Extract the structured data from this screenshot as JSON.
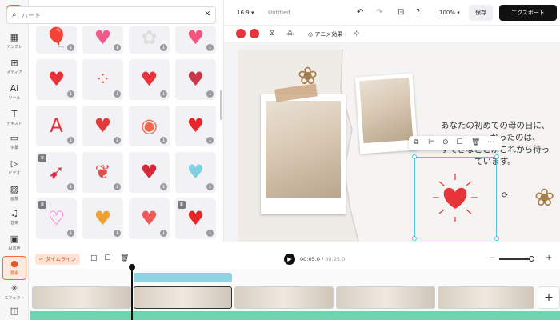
{
  "app": {
    "logo": "F"
  },
  "rail": {
    "items": [
      {
        "label": "テンプレ",
        "icon": "▦",
        "icon_name": "template-icon"
      },
      {
        "label": "メディア",
        "icon": "⊞",
        "icon_name": "media-icon"
      },
      {
        "label": "ツール",
        "icon": "AI",
        "icon_name": "ai-tools-icon"
      },
      {
        "label": "テキスト",
        "icon": "T",
        "icon_name": "text-icon"
      },
      {
        "label": "字幕",
        "icon": "▭",
        "icon_name": "subtitle-icon"
      },
      {
        "label": "ビデオ",
        "icon": "▷",
        "icon_name": "video-icon"
      },
      {
        "label": "画像",
        "icon": "▨",
        "icon_name": "image-icon"
      },
      {
        "label": "音楽",
        "icon": "♫",
        "icon_name": "music-icon"
      },
      {
        "label": "AI音声",
        "icon": "▣",
        "icon_name": "ai-voice-icon"
      },
      {
        "label": "要素",
        "icon": "●",
        "icon_name": "elements-icon"
      },
      {
        "label": "エフェクト",
        "icon": "✳",
        "icon_name": "effects-icon"
      },
      {
        "label": "",
        "icon": "◫",
        "icon_name": "more-icon"
      }
    ]
  },
  "search": {
    "placeholder": "ハート",
    "value": "ハート"
  },
  "stickers": [
    {
      "glyph": "🎈",
      "color": "#c0405a"
    },
    {
      "glyph": "♥",
      "color": "#f05a8a"
    },
    {
      "glyph": "✿",
      "color": "#dddddd"
    },
    {
      "glyph": "♥",
      "color": "#f5557a"
    },
    {
      "glyph": "♥",
      "color": "#e8333a"
    },
    {
      "glyph": "⁘",
      "color": "#e86a5a"
    },
    {
      "glyph": "♥",
      "color": "#e8333a"
    },
    {
      "glyph": "♥",
      "color": "#c83a4a"
    },
    {
      "glyph": "A",
      "color": "#e8333a"
    },
    {
      "glyph": "♥",
      "color": "#e03a3a"
    },
    {
      "glyph": "◉",
      "color": "#f06a50"
    },
    {
      "glyph": "♥",
      "color": "#e8262a"
    },
    {
      "glyph": "➹",
      "color": "#d8334a"
    },
    {
      "glyph": "❦",
      "color": "#e84a4a"
    },
    {
      "glyph": "♥",
      "color": "#d8263a"
    },
    {
      "glyph": "♥",
      "color": "#7fd0e0"
    },
    {
      "glyph": "♡",
      "color": "#ff4fcf"
    },
    {
      "glyph": "♥",
      "color": "#f0a030"
    },
    {
      "glyph": "♥",
      "color": "#f05a5a"
    },
    {
      "glyph": "♥",
      "color": "#e8262a"
    }
  ],
  "topbar": {
    "aspect": "16:9",
    "title": "Untitled",
    "zoom": "100%",
    "save": "保存",
    "export": "エクスポート"
  },
  "toolbar": {
    "colors": [
      "#e8333a",
      "#e8333a"
    ],
    "animate": "アニメ効果"
  },
  "canvas": {
    "message": [
      "あなたの初めての母の日に、",
      "かったのは、",
      "すてきなことがこれから待っ",
      "ています。"
    ]
  },
  "timeline": {
    "label": "タイムライン",
    "current": "00:05.0",
    "total": "00:25.0",
    "separator": "/"
  }
}
